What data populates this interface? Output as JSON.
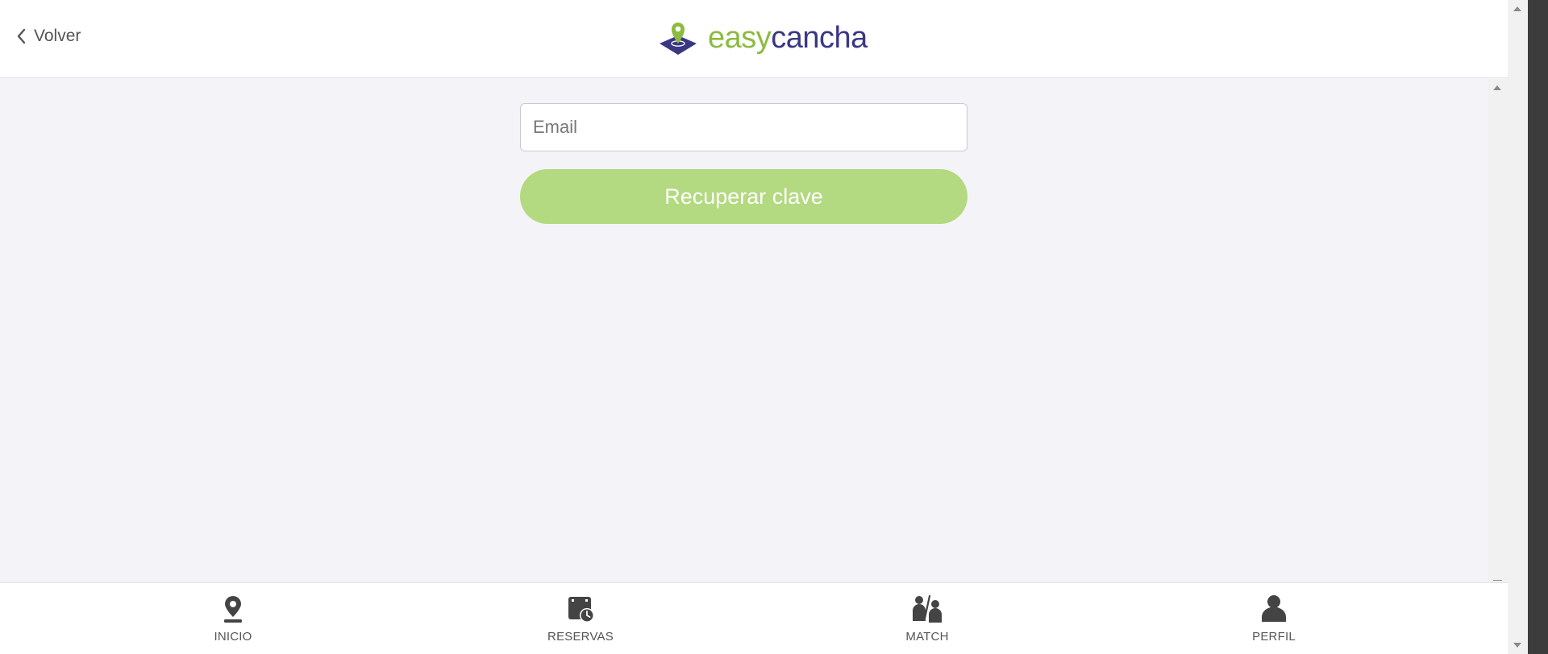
{
  "header": {
    "back_label": "Volver",
    "brand_part1": "easy",
    "brand_part2": "cancha"
  },
  "form": {
    "email_placeholder": "Email",
    "email_value": "",
    "submit_label": "Recuperar clave"
  },
  "bottom_nav": {
    "items": [
      {
        "label": "INICIO",
        "icon": "location-pin-icon"
      },
      {
        "label": "RESERVAS",
        "icon": "calendar-clock-icon"
      },
      {
        "label": "MATCH",
        "icon": "players-vs-icon"
      },
      {
        "label": "PERFIL",
        "icon": "user-icon"
      }
    ]
  },
  "colors": {
    "brand_green": "#8cbb3f",
    "brand_navy": "#3a3883",
    "button_green": "#b3d981",
    "background": "#f4f4f8"
  }
}
